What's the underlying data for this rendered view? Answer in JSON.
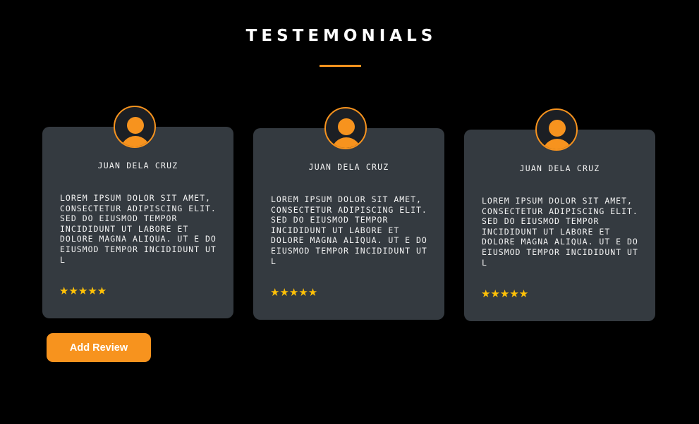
{
  "section": {
    "title": "TESTEMONIALS"
  },
  "testimonials": [
    {
      "name": "JUAN DELA CRUZ",
      "text": "LOREM IPSUM DOLOR SIT AMET, CONSECTETUR ADIPISCING ELIT. SED DO EIUSMOD TEMPOR INCIDIDUNT UT LABORE ET DOLORE MAGNA ALIQUA. UT E DO EIUSMOD TEMPOR INCIDIDUNT UT L",
      "stars": "★★★★★",
      "rating": 5,
      "avatar_icon": "user-avatar-icon"
    },
    {
      "name": "JUAN DELA CRUZ",
      "text": "LOREM IPSUM DOLOR SIT AMET, CONSECTETUR ADIPISCING ELIT. SED DO EIUSMOD TEMPOR INCIDIDUNT UT LABORE ET DOLORE MAGNA ALIQUA. UT E DO EIUSMOD TEMPOR INCIDIDUNT UT L",
      "stars": "★★★★★",
      "rating": 5,
      "avatar_icon": "user-avatar-icon"
    },
    {
      "name": "JUAN DELA CRUZ",
      "text": "LOREM IPSUM DOLOR SIT AMET, CONSECTETUR ADIPISCING ELIT. SED DO EIUSMOD TEMPOR INCIDIDUNT UT LABORE ET DOLORE MAGNA ALIQUA. UT E DO EIUSMOD TEMPOR INCIDIDUNT UT L",
      "stars": "★★★★★",
      "rating": 5,
      "avatar_icon": "user-avatar-icon"
    }
  ],
  "actions": {
    "add_review_label": "Add Review"
  },
  "colors": {
    "background": "#000000",
    "card": "#343a40",
    "accent": "#f7931e",
    "star": "#ffc107",
    "text": "#f2f2f2"
  }
}
